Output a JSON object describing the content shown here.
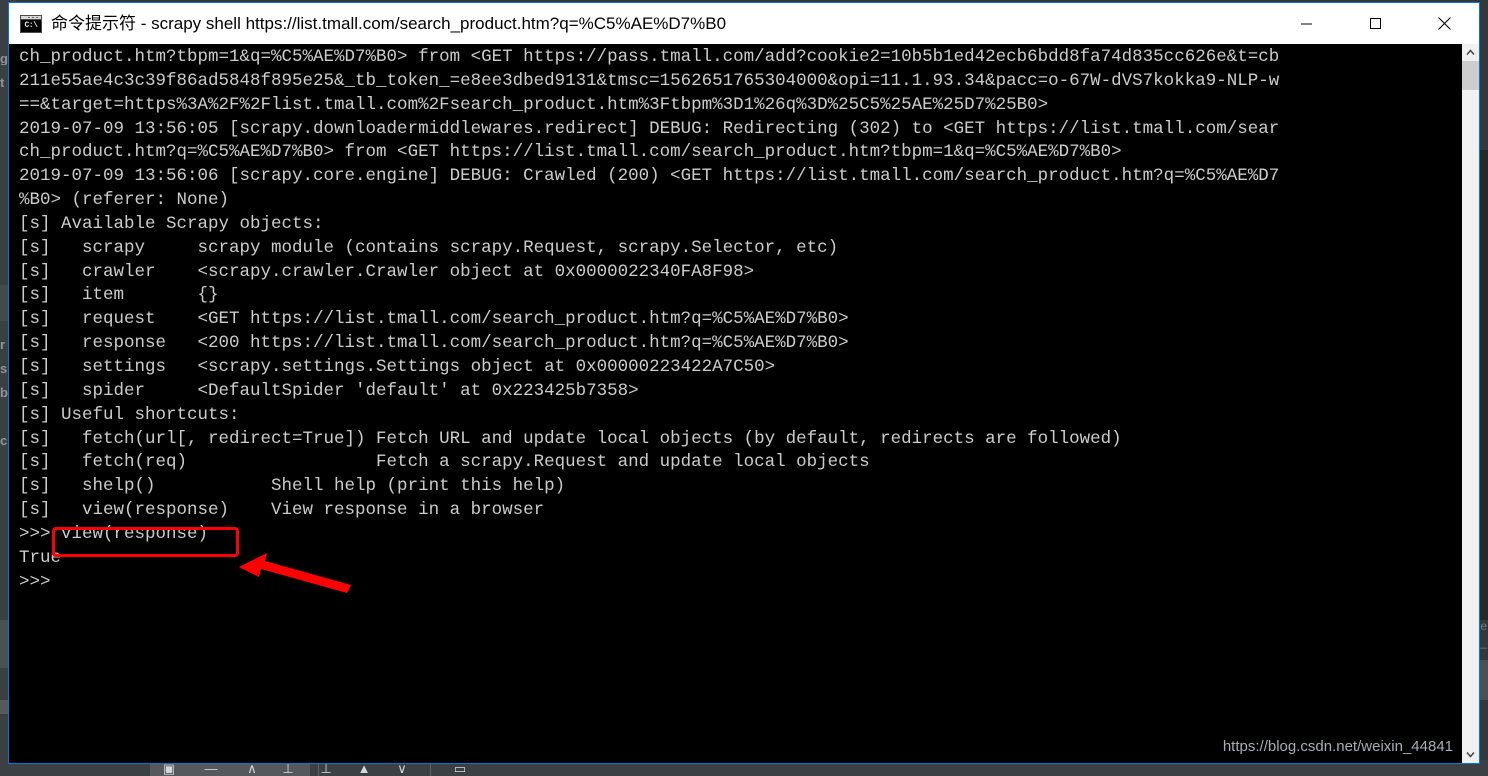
{
  "window": {
    "icon": "cmd-icon",
    "icon_text": "C:\\",
    "title": "命令提示符 - scrapy  shell https://list.tmall.com/search_product.htm?q=%C5%AE%D7%B0",
    "buttons": {
      "minimize": "minimize-icon",
      "maximize": "maximize-icon",
      "close": "close-icon"
    }
  },
  "console": {
    "lines": [
      "ch_product.htm?tbpm=1&q=%C5%AE%D7%B0> from <GET https://pass.tmall.com/add?cookie2=10b5b1ed42ecb6bdd8fa74d835cc626e&t=cb",
      "211e55ae4c3c39f86ad5848f895e25&_tb_token_=e8ee3dbed9131&tmsc=1562651765304000&opi=11.1.93.34&pacc=o-67W-dVS7kokka9-NLP-w",
      "==&target=https%3A%2F%2Flist.tmall.com%2Fsearch_product.htm%3Ftbpm%3D1%26q%3D%25C5%25AE%25D7%25B0>",
      "2019-07-09 13:56:05 [scrapy.downloadermiddlewares.redirect] DEBUG: Redirecting (302) to <GET https://list.tmall.com/sear",
      "ch_product.htm?q=%C5%AE%D7%B0> from <GET https://list.tmall.com/search_product.htm?tbpm=1&q=%C5%AE%D7%B0>",
      "2019-07-09 13:56:06 [scrapy.core.engine] DEBUG: Crawled (200) <GET https://list.tmall.com/search_product.htm?q=%C5%AE%D7",
      "%B0> (referer: None)",
      "[s] Available Scrapy objects:",
      "[s]   scrapy     scrapy module (contains scrapy.Request, scrapy.Selector, etc)",
      "[s]   crawler    <scrapy.crawler.Crawler object at 0x0000022340FA8F98>",
      "[s]   item       {}",
      "[s]   request    <GET https://list.tmall.com/search_product.htm?q=%C5%AE%D7%B0>",
      "[s]   response   <200 https://list.tmall.com/search_product.htm?q=%C5%AE%D7%B0>",
      "[s]   settings   <scrapy.settings.Settings object at 0x00000223422A7C50>",
      "[s]   spider     <DefaultSpider 'default' at 0x223425b7358>",
      "[s] Useful shortcuts:",
      "[s]   fetch(url[, redirect=True]) Fetch URL and update local objects (by default, redirects are followed)",
      "[s]   fetch(req)                  Fetch a scrapy.Request and update local objects",
      "[s]   shelp()           Shell help (print this help)",
      "[s]   view(response)    View response in a browser",
      ">>> view(response)",
      "True",
      ">>>"
    ]
  },
  "scrollbar": {
    "up_arrow": "chevron-up-icon",
    "down_arrow": "chevron-down-icon"
  },
  "annotations": {
    "highlight_box_label": "view(response)",
    "arrow_color": "#ff0000",
    "box_color": "#ff0000"
  },
  "watermark": {
    "text": "https://blog.csdn.net/weixin_44841"
  },
  "background": {
    "left_ghost_lines": [
      "g",
      "t",
      "",
      "",
      "",
      "",
      "",
      "",
      "",
      "",
      "r",
      "s",
      "b",
      "",
      "c"
    ],
    "right_ghost_text": "e"
  },
  "colors": {
    "console_bg": "#000000",
    "console_fg": "#cccccc",
    "window_border": "#0078d7",
    "titlebar_bg": "#ffffff",
    "accent_red": "#ff0000",
    "scrollbar_track": "#f0f0f0",
    "scrollbar_thumb": "#cdcdcd"
  }
}
